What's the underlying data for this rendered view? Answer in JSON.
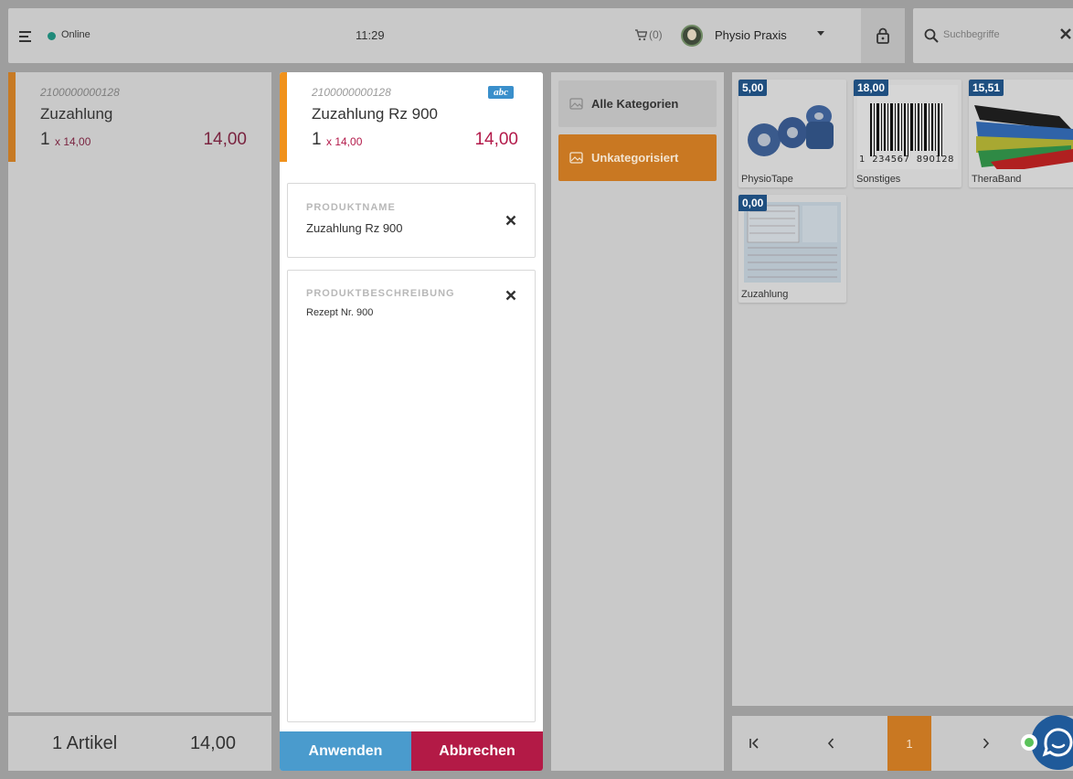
{
  "header": {
    "status": "Online",
    "time": "11:29",
    "cart_count": "(0)",
    "account": "Physio Praxis"
  },
  "search": {
    "placeholder": "Suchbegriffe",
    "value": ""
  },
  "cart": {
    "item": {
      "sku": "2100000000128",
      "name": "Zuzahlung",
      "qty": "1",
      "unit_price": "x 14,00",
      "total": "14,00"
    },
    "footer": {
      "count": "1 Artikel",
      "sum": "14,00"
    }
  },
  "editor": {
    "item": {
      "sku": "2100000000128",
      "name": "Zuzahlung Rz 900",
      "qty": "1",
      "unit_price": "x 14,00",
      "total": "14,00",
      "badge": "abc"
    },
    "name_field": {
      "label": "PRODUKTNAME",
      "value": "Zuzahlung Rz 900"
    },
    "desc_field": {
      "label": "PRODUKTBESCHREIBUNG",
      "value": "Rezept Nr. 900"
    },
    "apply": "Anwenden",
    "cancel": "Abbrechen"
  },
  "categories": [
    {
      "label": "Alle Kategorien",
      "active": false
    },
    {
      "label": "Unkategorisiert",
      "active": true
    }
  ],
  "products": [
    {
      "price": "5,00",
      "name": "PhysioTape",
      "icon": "tape-image"
    },
    {
      "price": "18,00",
      "name": "Sonstiges",
      "icon": "barcode-image"
    },
    {
      "price": "15,51",
      "name": "TheraBand",
      "icon": "bands-image"
    },
    {
      "price": "0,00",
      "name": "Zuzahlung",
      "icon": "form-image"
    }
  ],
  "barcode_text": "1  234567  890128  >",
  "pager": {
    "current": "1"
  },
  "colors": {
    "accent": "#c97822",
    "primary": "#4a9bcd",
    "danger": "#b31a46",
    "price": "#1f4f80"
  }
}
